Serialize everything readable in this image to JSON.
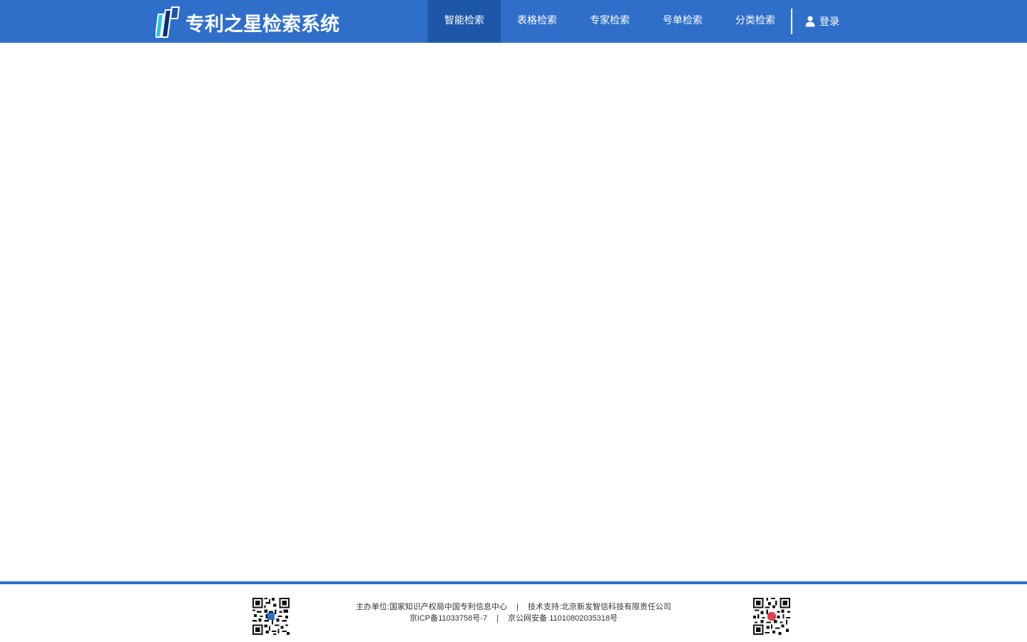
{
  "header": {
    "title": "专利之星检索系统",
    "background_color": "#2f6fca",
    "active_tab_color": "#1e56a8",
    "nav": [
      {
        "label": "智能检索",
        "active": true
      },
      {
        "label": "表格检索",
        "active": false
      },
      {
        "label": "专家检索",
        "active": false
      },
      {
        "label": "号单检索",
        "active": false
      },
      {
        "label": "分类检索",
        "active": false
      }
    ],
    "login": {
      "label": "登录",
      "icon": "user-icon"
    }
  },
  "footer": {
    "line1": {
      "sponsor": "主办单位:国家知识产权局中国专利信息中心",
      "separator": "|",
      "support": "技术支持:北京新发智信科技有限责任公司"
    },
    "line2": {
      "icp": "京ICP备11033758号-7",
      "separator": "|",
      "police": "京公网安备 11010802035318号"
    },
    "qr_codes": [
      "qr-code-icon",
      "qr-code-icon"
    ]
  }
}
